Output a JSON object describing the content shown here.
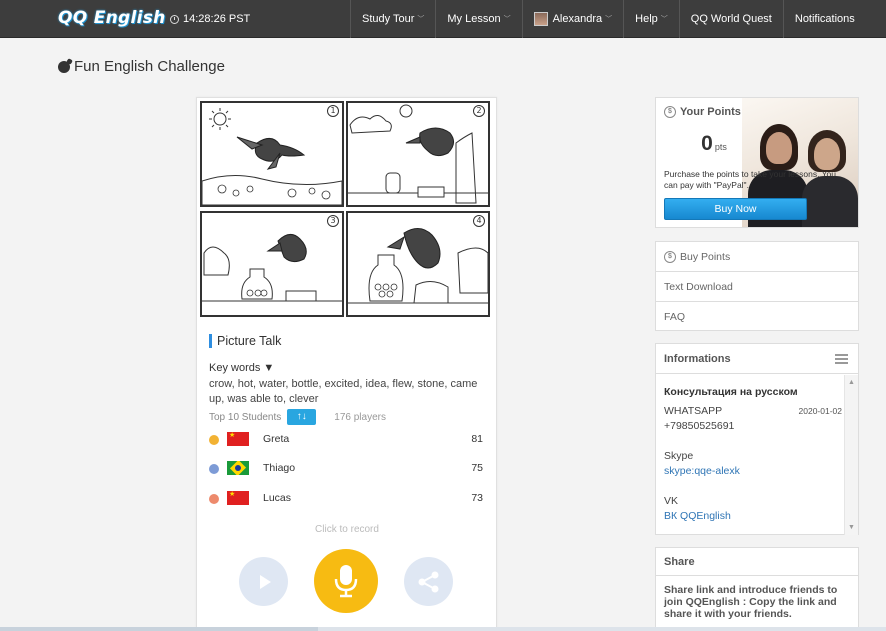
{
  "header": {
    "logo": "QQ English",
    "clock": "14:28:26 PST",
    "nav": [
      {
        "label": "Study Tour",
        "caret": "﹀"
      },
      {
        "label": "My Lesson",
        "caret": "﹀"
      },
      {
        "label": "Alexandra",
        "caret": "﹀"
      },
      {
        "label": "Help",
        "caret": "﹀"
      },
      {
        "label": "QQ World Quest"
      },
      {
        "label": "Notifications"
      }
    ]
  },
  "page": {
    "title": "Fun English Challenge"
  },
  "comic": {
    "panel_numbers": [
      "1",
      "2",
      "3",
      "4"
    ]
  },
  "challenge": {
    "section_label": "Picture Talk",
    "keywords_title": "Key words ▼",
    "keywords": "crow, hot, water, bottle, excited, idea, flew, stone, came up, was able to, clever",
    "top_label": "Top 10 Students",
    "sort_label": "↑↓",
    "players": "176 players",
    "students": [
      {
        "rank": "1",
        "medal": "gold",
        "country": "cn",
        "name": "Greta",
        "score": "81"
      },
      {
        "rank": "2",
        "medal": "silver",
        "country": "br",
        "name": "Thiago",
        "score": "75"
      },
      {
        "rank": "3",
        "medal": "bronze",
        "country": "cn",
        "name": "Lucas",
        "score": "73"
      }
    ],
    "record_hint": "Click to record"
  },
  "points": {
    "title": "Your Points",
    "value": "0",
    "unit": "pts",
    "description": "Purchase the points to take your lessons. You can pay with \"PayPal\".",
    "buy_label": "Buy Now"
  },
  "links": [
    "Buy Points",
    "Text Download",
    "FAQ"
  ],
  "info": {
    "title": "Informations",
    "ru_title": "Консультация на русском",
    "whatsapp_label": "WHATSAPP",
    "whatsapp_date": "2020-01-02",
    "whatsapp_number": "+79850525691",
    "skype_label": "Skype",
    "skype_link": "skype:qqe-alexk",
    "vk_label": "VK",
    "vk_link": "ВК QQEnglish"
  },
  "share": {
    "title": "Share",
    "text": "Share link and introduce friends to join QQEnglish : Copy the link and share it with your friends."
  },
  "colors": {
    "nav_bg": "#3d3d3d",
    "accent_blue": "#29a6e0",
    "mic_yellow": "#f7bb12",
    "link_blue": "#2f75b5"
  }
}
